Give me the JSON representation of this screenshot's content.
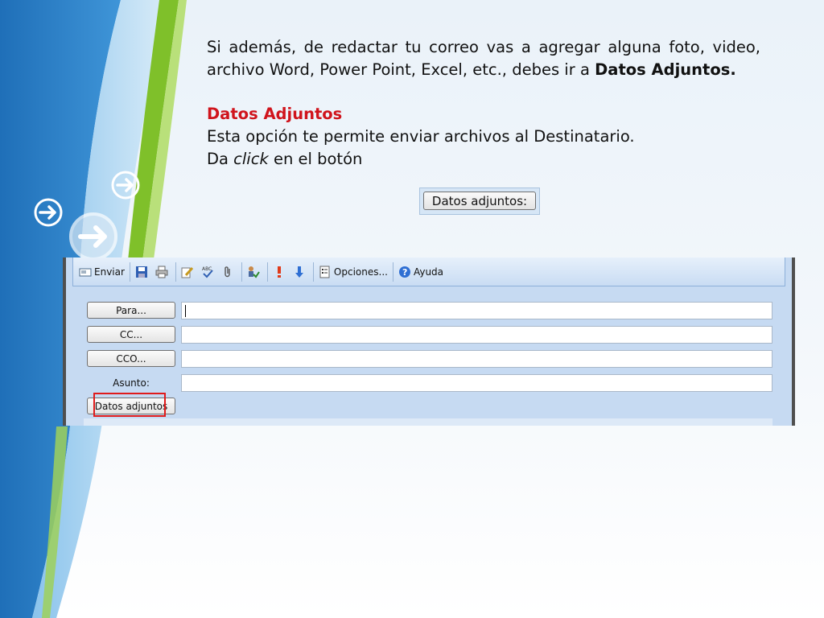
{
  "slide": {
    "intro_1": "Si además, de redactar tu correo vas a agregar alguna foto, video, archivo Word, Power Point, Excel, etc., debes ir a ",
    "intro_bold": "Datos Adjuntos.",
    "section_title": "Datos Adjuntos",
    "description": "Esta opción te permite enviar archivos al Destinatario.",
    "instruction_prefix": "Da ",
    "instruction_italic": "click",
    "instruction_suffix": " en el botón",
    "inline_button_label": "Datos adjuntos:"
  },
  "email_window": {
    "toolbar": {
      "send_label": "Enviar",
      "options_label": "Opciones...",
      "help_label": "Ayuda",
      "icons": [
        "send-icon",
        "save-icon",
        "print-icon",
        "edit-icon",
        "spellcheck-icon",
        "attach-icon",
        "check-names-icon",
        "importance-high-icon",
        "importance-low-icon",
        "options-icon",
        "help-icon"
      ]
    },
    "fields": {
      "to_button": "Para...",
      "cc_button": "CC...",
      "bcc_button": "CCO...",
      "subject_label": "Asunto:",
      "attachments_button": "Datos adjuntos",
      "to_value": "",
      "cc_value": "",
      "bcc_value": "",
      "subject_value": ""
    },
    "colors": {
      "highlight": "#e01b1b",
      "section_title": "#d0141c"
    }
  }
}
